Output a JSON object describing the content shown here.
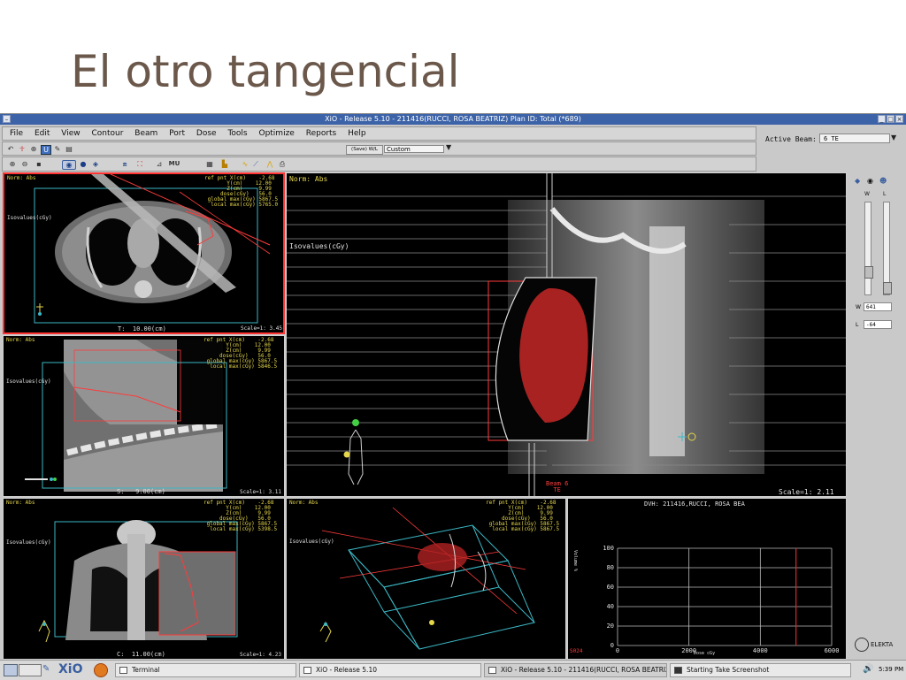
{
  "slide": {
    "title": "El otro tangencial"
  },
  "window": {
    "title": "XiO - Release 5.10 - 211416(RUCCI, ROSA BEATRIZ) Plan ID: Total (*689)",
    "minimize_icon": "minimize-icon",
    "close_icon": "close-icon"
  },
  "menu": [
    "File",
    "Edit",
    "View",
    "Contour",
    "Beam",
    "Port",
    "Dose",
    "Tools",
    "Optimize",
    "Reports",
    "Help"
  ],
  "toolbar": {
    "wl_button": "(Save) W/L",
    "wl_select": "Custom",
    "mu_label": "MU"
  },
  "active_beam": {
    "label": "Active Beam:",
    "value": "6 TE"
  },
  "panel_right": {
    "w_label": "W",
    "l_label": "L",
    "w_field_label": "W",
    "w_value": "641",
    "l_field_label": "L",
    "l_value": "-64",
    "logo": "ELEKTA"
  },
  "axial": {
    "header": "Norm: Abs",
    "iso": "Isovalues(cGy)",
    "ref": "ref pnt X(cm)    -2.68\n       Y(cm)    12.00\n       Z(cm)     9.99\n     dose(cGy)   56.0\n global max(cGy) 5867.5\n  local max(cGy) 5765.0",
    "slice": "T:  10.00(cm)",
    "scale": "Scale=1: 3.45"
  },
  "sagittal": {
    "header": "Norm: Abs",
    "iso": "Isovalues(cGy)",
    "ref": "ref pnt X(cm)    -2.68\n       Y(cm)    12.00\n       Z(cm)     9.99\n     dose(cGy)   56.0\n global max(cGy) 5867.5\n  local max(cGy) 5846.5",
    "slice": "S:   9.00(cm)",
    "scale": "Scale=1: 3.11"
  },
  "coronal": {
    "header": "Norm: Abs",
    "iso": "Isovalues(cGy)",
    "ref": "ref pnt X(cm)    -2.68\n       Y(cm)    12.00\n       Z(cm)     9.99\n     dose(cGy)   56.0\n global max(cGy) 5867.5\n  local max(cGy) 5398.5",
    "slice": "C:  11.00(cm)",
    "scale": "Scale=1: 4.23"
  },
  "bev": {
    "header": "Norm: Abs",
    "iso": "Isovalues(cGy)",
    "beam": "Beam 6\n  TE",
    "scale": "Scale=1: 2.11"
  },
  "view3d": {
    "header": "Norm: Abs",
    "iso": "Isovalues(cGy)",
    "ref": "ref pnt X(cm)    -2.68\n       Y(cm)    12.00\n       Z(cm)     9.99\n     dose(cGy)   56.0\n global max(cGy) 5867.5\n  local max(cGy) 5867.5"
  },
  "dvh": {
    "title": "DVH: 211416,RUCCI, ROSA BEA",
    "corner": "S024",
    "chart_data": {
      "type": "line",
      "title": "DVH: 211416,RUCCI, ROSA BEA",
      "xlabel": "Dose cGy",
      "ylabel": "Volume %",
      "xlim": [
        0,
        6000
      ],
      "ylim": [
        0,
        100
      ],
      "x_ticks": [
        "0",
        "2000",
        "4000",
        "6000"
      ],
      "y_ticks": [
        "0",
        "20",
        "40",
        "60",
        "80",
        "100"
      ],
      "grid": true,
      "markers": [
        {
          "x": 5000,
          "color": "#d22b2b"
        }
      ]
    }
  },
  "taskbar": {
    "xio_logo": "XiO",
    "items": [
      "Terminal",
      "XiO - Release 5.10",
      "XiO - Release 5.10 - 211416(RUCCI, ROSA BEATRIZ) ...",
      "Starting Take Screenshot"
    ],
    "clock": "5:39 PM"
  }
}
